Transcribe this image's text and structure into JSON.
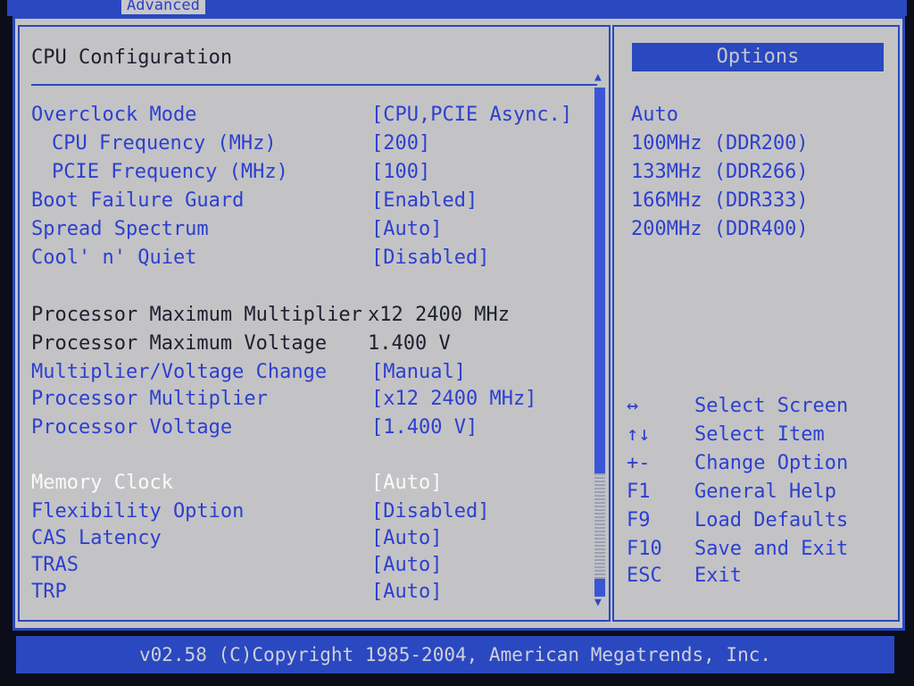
{
  "window": {
    "tab_label": "Advanced"
  },
  "main": {
    "title": "CPU Configuration",
    "settings": [
      {
        "label": "Overclock Mode",
        "value": "[CPU,PCIE Async.]"
      },
      {
        "label": "CPU Frequency (MHz)",
        "value": "[200]"
      },
      {
        "label": "PCIE Frequency (MHz)",
        "value": "[100]"
      },
      {
        "label": "Boot Failure Guard",
        "value": "[Enabled]"
      },
      {
        "label": "Spread Spectrum",
        "value": "[Auto]"
      },
      {
        "label": "Cool' n' Quiet",
        "value": "[Disabled]"
      },
      {
        "label": "Processor Maximum Multiplier",
        "value": "x12 2400 MHz"
      },
      {
        "label": "Processor Maximum Voltage",
        "value": "1.400 V"
      },
      {
        "label": "Multiplier/Voltage Change",
        "value": "[Manual]"
      },
      {
        "label": "Processor Multiplier",
        "value": "[x12 2400 MHz]"
      },
      {
        "label": "Processor Voltage",
        "value": "[1.400 V]"
      },
      {
        "label": "Memory Clock",
        "value": "[Auto]"
      },
      {
        "label": "Flexibility Option",
        "value": "[Disabled]"
      },
      {
        "label": "CAS Latency",
        "value": "[Auto]"
      },
      {
        "label": "TRAS",
        "value": "[Auto]"
      },
      {
        "label": "TRP",
        "value": "[Auto]"
      }
    ]
  },
  "options": {
    "header": "Options",
    "items": [
      "Auto",
      "100MHz (DDR200)",
      "133MHz (DDR266)",
      "166MHz (DDR333)",
      "200MHz (DDR400)"
    ]
  },
  "keys": [
    {
      "key": "↔",
      "desc": "Select Screen"
    },
    {
      "key": "↑↓",
      "desc": "Select Item"
    },
    {
      "key": "+-",
      "desc": "Change Option"
    },
    {
      "key": "F1",
      "desc": "General Help"
    },
    {
      "key": "F9",
      "desc": "Load Defaults"
    },
    {
      "key": "F10",
      "desc": "Save and Exit"
    },
    {
      "key": "ESC",
      "desc": "Exit"
    }
  ],
  "footer": {
    "text": "v02.58 (C)Copyright 1985-2004, American Megatrends, Inc."
  },
  "colors": {
    "bios_blue": "#2a48c0",
    "background": "#c3c3c5",
    "highlight": "#fafafa"
  }
}
